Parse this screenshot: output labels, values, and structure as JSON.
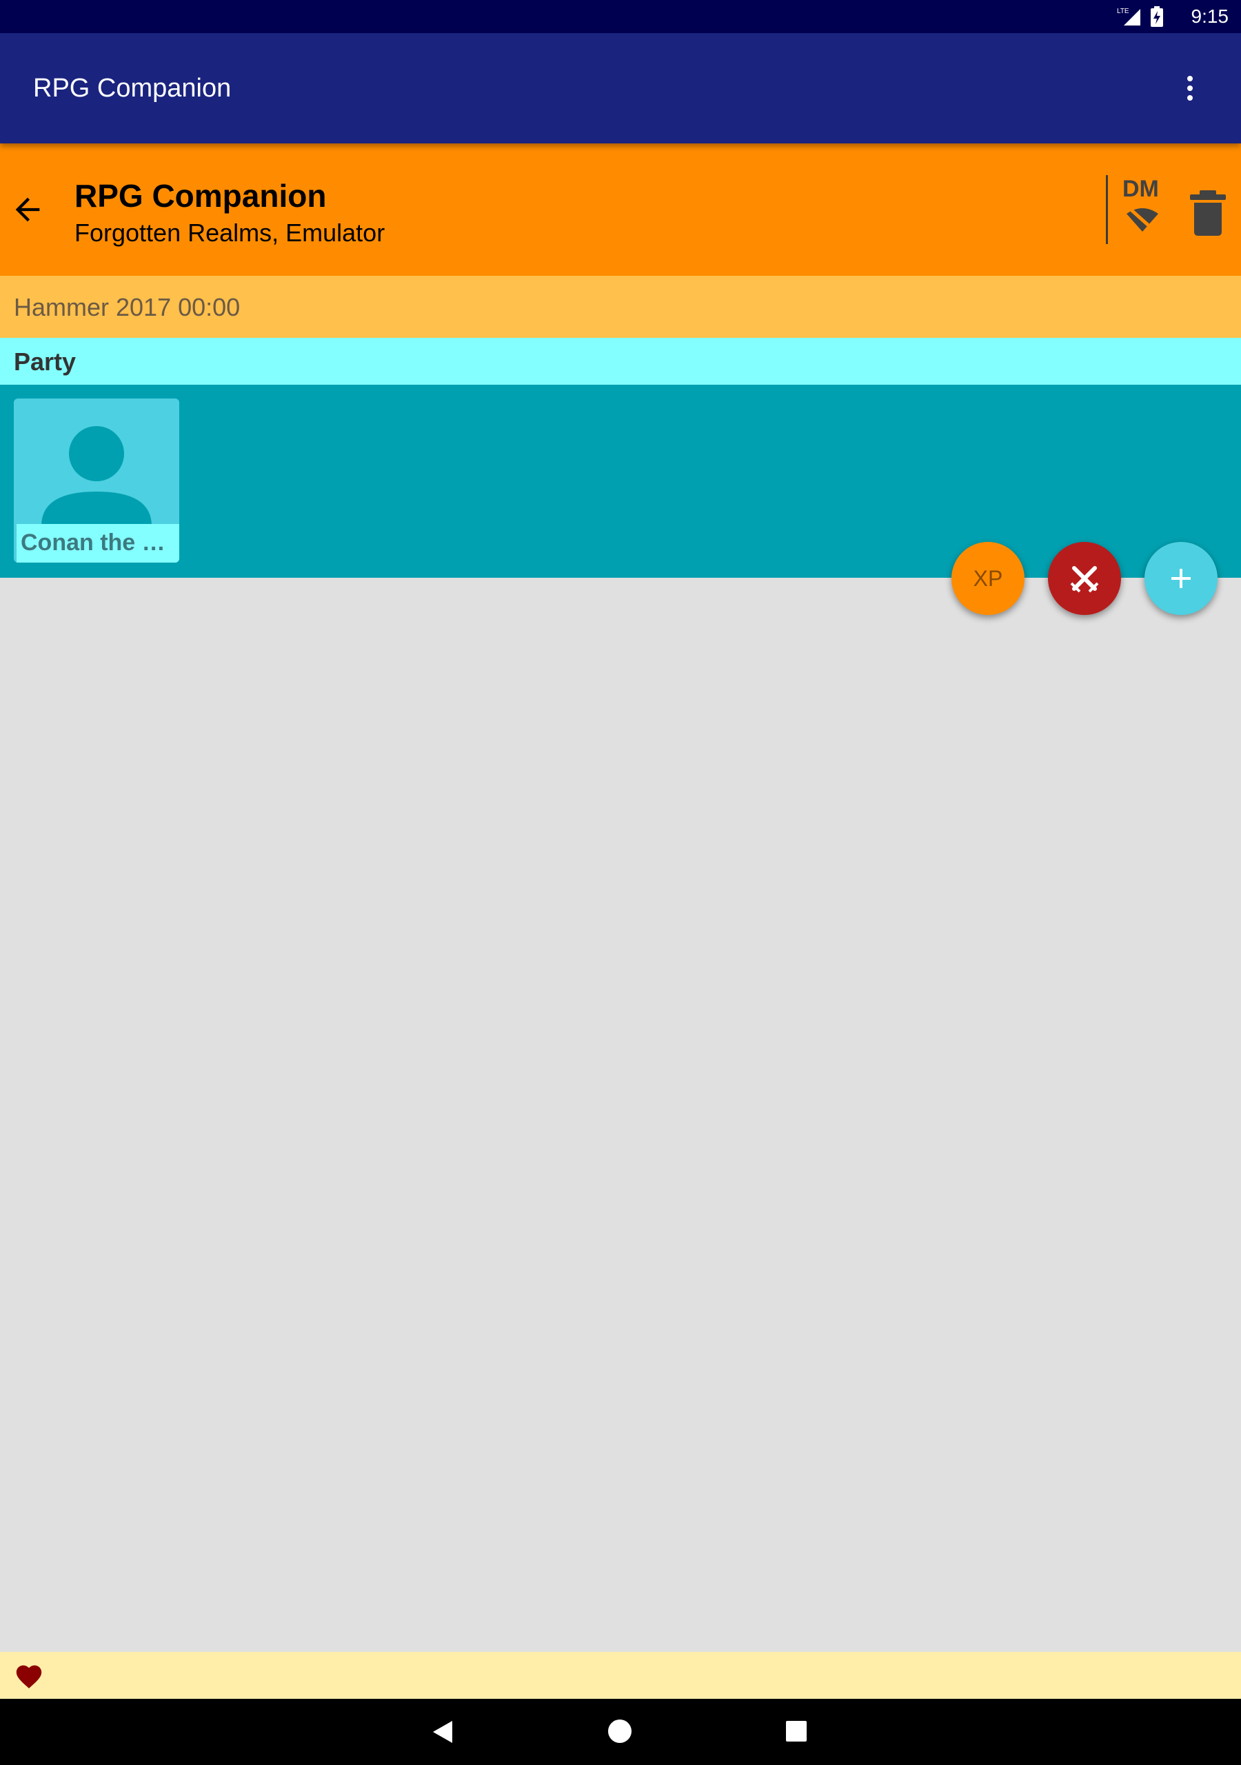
{
  "status_bar": {
    "time": "9:15",
    "network": "LTE",
    "icons": [
      "lte-signal-icon",
      "battery-charging-icon"
    ]
  },
  "app_bar": {
    "title": "RPG Companion",
    "menu_icon": "overflow-menu-icon"
  },
  "session": {
    "title": "RPG Companion",
    "subtitle": "Forgotten Realms, Emulator",
    "dm_label": "DM",
    "icons": [
      "back-arrow-icon",
      "wifi-off-icon",
      "trash-icon"
    ]
  },
  "date_row": {
    "text": "Hammer 2017 00:00"
  },
  "party": {
    "header": "Party",
    "characters": [
      {
        "name": "Conan the Barbarian",
        "display_name": "Conan the B…",
        "icon": "person-avatar-icon"
      }
    ]
  },
  "fabs": {
    "xp_label": "XP",
    "combat_icon": "crossed-swords-icon",
    "add_icon": "plus-icon"
  },
  "bottom_bar": {
    "icon": "heart-icon"
  },
  "nav_bar": {
    "icons": [
      "nav-back-icon",
      "nav-home-icon",
      "nav-recents-icon"
    ]
  },
  "colors": {
    "status_bar": "#000050",
    "app_bar": "#1a237e",
    "session_header": "#ff8c00",
    "date_row": "#ffc04c",
    "party_header": "#84ffff",
    "party_area": "#00a0b0",
    "fab_xp": "#ff8c00",
    "fab_combat": "#b71c1c",
    "fab_add": "#4dd0e1",
    "bottom_bar": "#ffeeaa",
    "background": "#e0e0e0"
  }
}
